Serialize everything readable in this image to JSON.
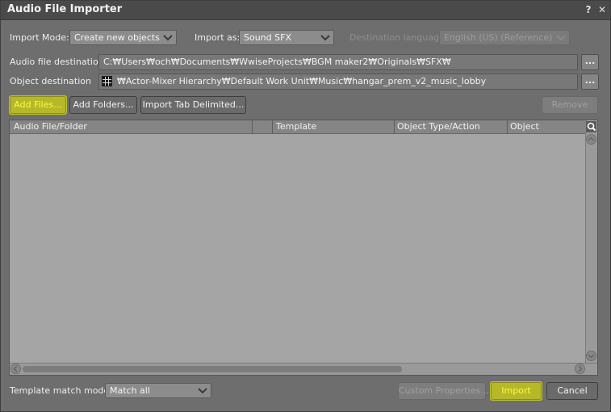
{
  "window": {
    "title": "Audio File Importer",
    "help_label": "?",
    "close_label": "✕"
  },
  "import_mode": {
    "label": "Import Mode:",
    "value": "Create new objects"
  },
  "import_as": {
    "label": "Import as:",
    "value": "Sound SFX"
  },
  "destination_language": {
    "label": "Destination language:",
    "value": "English (US) (Reference)"
  },
  "audio_file_destination": {
    "label": "Audio file destination",
    "value": "C:₩Users₩och₩Documents₩WwiseProjects₩BGM maker2₩Originals₩SFX₩",
    "browse_label": "..."
  },
  "object_destination": {
    "label": "Object destination",
    "value": "₩Actor-Mixer Hierarchy₩Default Work Unit₩Music₩hangar_prem_v2_music_lobby",
    "browse_label": "..."
  },
  "toolbar": {
    "add_files": "Add Files...",
    "add_folders": "Add Folders...",
    "import_tab_delimited": "Import Tab Delimited...",
    "remove": "Remove"
  },
  "table": {
    "columns": [
      "Audio File/Folder",
      "Template",
      "Object Type/Action",
      "Object"
    ]
  },
  "template_match": {
    "label": "Template match mode:",
    "value": "Match all"
  },
  "footer": {
    "custom_properties": "Custom Properties...",
    "import": "Import",
    "cancel": "Cancel"
  },
  "colors": {
    "highlight": "#bfc12b",
    "highlight_text": "#fbfb40"
  }
}
